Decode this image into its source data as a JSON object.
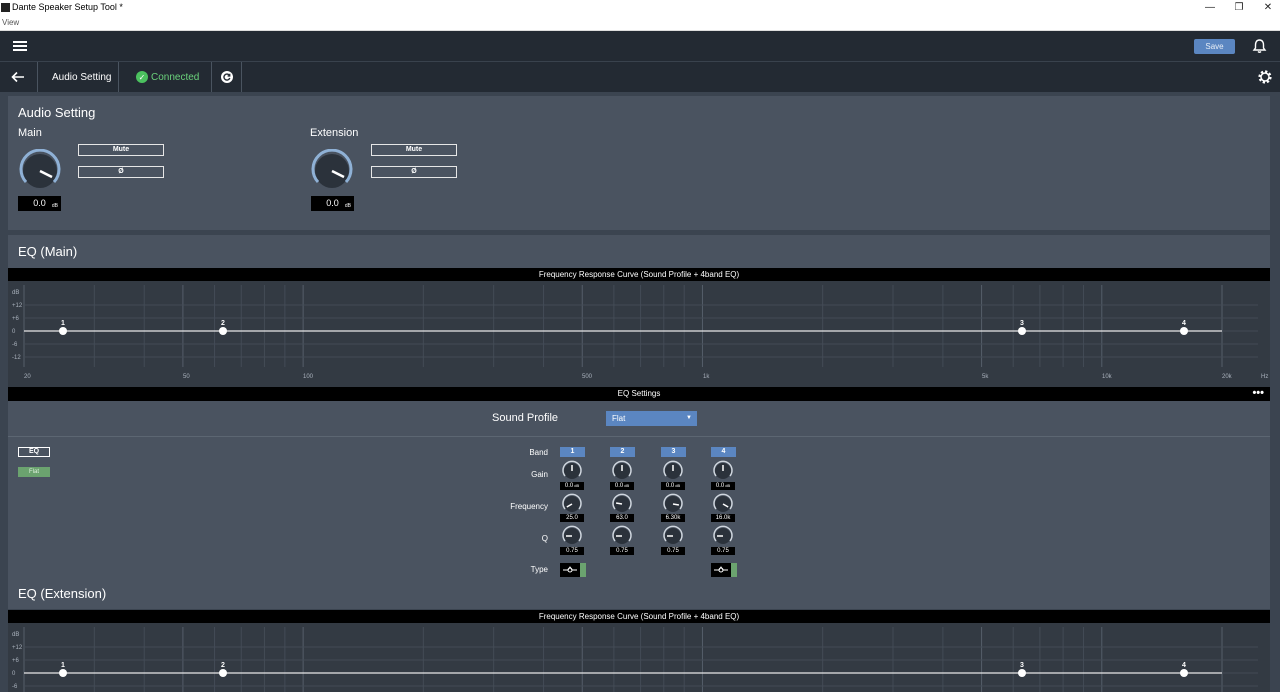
{
  "window": {
    "title": "Dante Speaker Setup Tool *",
    "menu_view": "View",
    "min": "—",
    "restore": "❐",
    "close": "✕"
  },
  "header": {
    "save_label": "Save"
  },
  "subheader": {
    "page": "Audio Setting",
    "status": "Connected"
  },
  "audio": {
    "title": "Audio Setting",
    "main": {
      "label": "Main",
      "mute": "Mute",
      "phase": "Ø",
      "value": "0.0",
      "unit": "dB"
    },
    "extension": {
      "label": "Extension",
      "mute": "Mute",
      "phase": "Ø",
      "value": "0.0",
      "unit": "dB"
    }
  },
  "eq_main": {
    "title": "EQ (Main)",
    "graph_title": "Frequency Response Curve (Sound Profile + 4band EQ)",
    "y_labels": [
      "dB",
      "+12",
      "+6",
      "0",
      "-6",
      "-12"
    ],
    "x_labels": [
      "20",
      "50",
      "100",
      "500",
      "1k",
      "5k",
      "10k",
      "20k",
      "Hz"
    ],
    "points": [
      "1",
      "2",
      "3",
      "4"
    ]
  },
  "eq_settings": {
    "title": "EQ Settings",
    "more": "•••",
    "sound_profile_label": "Sound Profile",
    "sound_profile_value": "Flat",
    "eq_label": "EQ",
    "flat_label": "Flat",
    "row_band": "Band",
    "row_gain": "Gain",
    "row_freq": "Frequency",
    "row_q": "Q",
    "row_type": "Type",
    "bands": [
      {
        "n": "1",
        "gain": "0.0",
        "freq": "25.0",
        "q": "0.75"
      },
      {
        "n": "2",
        "gain": "0.0",
        "freq": "63.0",
        "q": "0.75"
      },
      {
        "n": "3",
        "gain": "0.0",
        "freq": "6.30k",
        "q": "0.75"
      },
      {
        "n": "4",
        "gain": "0.0",
        "freq": "16.0k",
        "q": "0.75"
      }
    ],
    "gain_unit": "dB"
  },
  "eq_ext": {
    "title": "EQ (Extension)",
    "graph_title": "Frequency Response Curve (Sound Profile + 4band EQ)",
    "y_labels": [
      "dB",
      "+12",
      "+6",
      "0",
      "-6"
    ],
    "points": [
      "1",
      "2",
      "3",
      "4"
    ]
  },
  "colors": {
    "accent": "#5b86c1",
    "connected": "#4bc15f",
    "panel": "#4a5360",
    "bg": "#3b4450"
  }
}
